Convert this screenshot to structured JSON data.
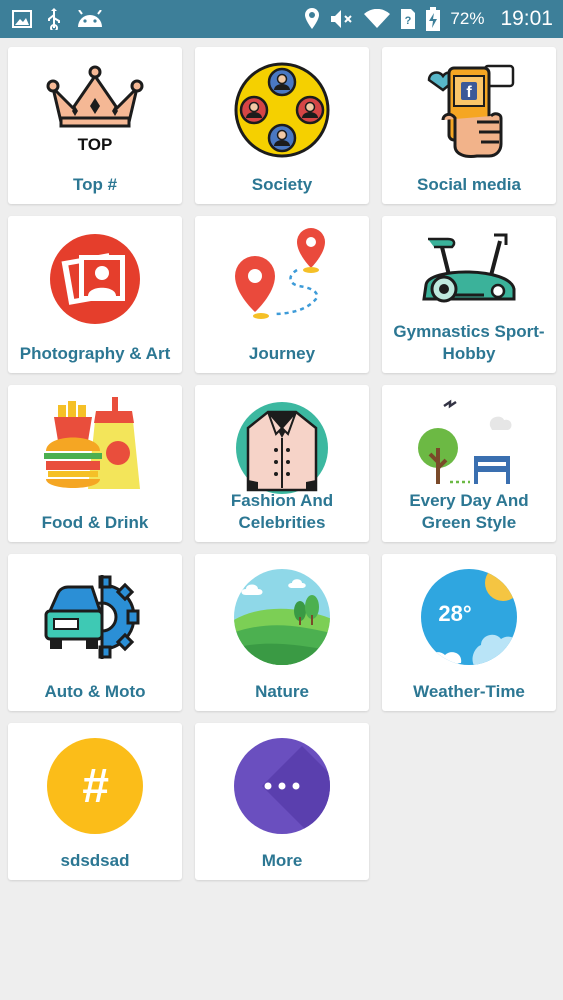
{
  "status_bar": {
    "battery": "72%",
    "time": "19:01"
  },
  "categories": [
    {
      "label": "Top #",
      "icon": "crown-top-icon"
    },
    {
      "label": "Society",
      "icon": "people-circle-icon"
    },
    {
      "label": "Social media",
      "icon": "phone-social-icon"
    },
    {
      "label": "Photography & Art",
      "icon": "photo-icon"
    },
    {
      "label": "Journey",
      "icon": "map-pin-route-icon"
    },
    {
      "label": "Gymnastics Sport-Hobby",
      "icon": "exercise-bike-icon"
    },
    {
      "label": "Food & Drink",
      "icon": "burger-fries-drink-icon"
    },
    {
      "label": "Fashion And Celebrities",
      "icon": "jacket-icon"
    },
    {
      "label": "Every Day And Green Style",
      "icon": "tree-bench-icon"
    },
    {
      "label": "Auto & Moto",
      "icon": "car-gear-icon"
    },
    {
      "label": "Nature",
      "icon": "landscape-icon"
    },
    {
      "label": "Weather-Time",
      "icon": "weather-sun-icon"
    },
    {
      "label": "sdsdsad",
      "icon": "hashtag-icon"
    },
    {
      "label": "More",
      "icon": "more-dots-icon"
    }
  ],
  "icons": {
    "top_text": "TOP",
    "weather_temp": "28°",
    "social_letter": "f",
    "hashtag": "#"
  },
  "colors": {
    "status_bar": "#3d7f99",
    "label_text": "#2c7793",
    "background": "#eeeeee"
  }
}
